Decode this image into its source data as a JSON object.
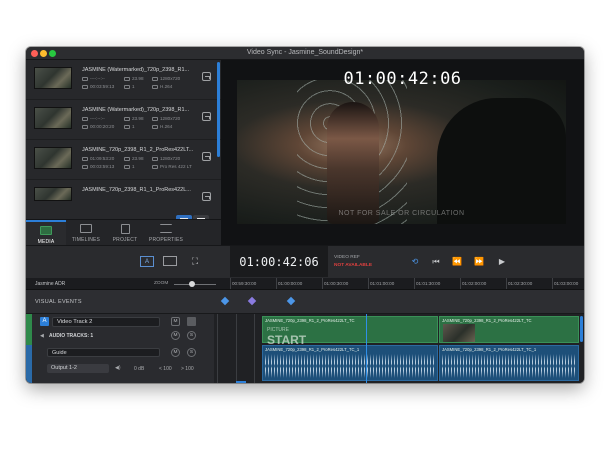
{
  "window": {
    "title": "Video Sync - Jasmine_SoundDesign*"
  },
  "media_items": [
    {
      "name": "JASMINE (Watermarked)_720p_2398_R1...",
      "row1a": "----:--:--",
      "row1b": "23.98",
      "row1c": "1280x720",
      "row2a": "00:03:59:13",
      "row2b": "1",
      "row2c": "H.264"
    },
    {
      "name": "JASMINE (Watermarked)_720p_2398_R1...",
      "row1a": "----:--:--",
      "row1b": "23.98",
      "row1c": "1280x720",
      "row2a": "00:00:20:20",
      "row2b": "1",
      "row2c": "H.264"
    },
    {
      "name": "JASMINE_720p_2398_R1_2_ProRes422LT...",
      "row1a": "01:09:53:20",
      "row1b": "23.98",
      "row1c": "1280x720",
      "row2a": "00:03:59:13",
      "row2b": "1",
      "row2c": "Pro Res 422 LT"
    },
    {
      "name": "JASMINE_720p_2398_R1_1_ProRes422L...",
      "row1a": "",
      "row1b": "",
      "row1c": "",
      "row2a": "",
      "row2b": "",
      "row2c": ""
    }
  ],
  "tabs": [
    {
      "label": "MEDIA",
      "icon": "film-icon"
    },
    {
      "label": "TIMELINES",
      "icon": "timeline-icon"
    },
    {
      "label": "PROJECT",
      "icon": "document-icon"
    },
    {
      "label": "PROPERTIES",
      "icon": "list-icon"
    }
  ],
  "viewer": {
    "timecode_overlay": "01:00:42:06",
    "watermark": "NOT FOR SALE OR CIRCULATION"
  },
  "transport": {
    "timecode": "01:00:42:06",
    "video_ref_label": "VIDEO REF",
    "video_ref_status": "NOT AVAILABLE",
    "a_button": "A"
  },
  "timeline_header": {
    "project": "Jasmine ADR",
    "zoom_label": "ZOOM",
    "ruler": [
      "00:59:30:00",
      "01:00:00:00",
      "01:00:30:00",
      "01:01:00:00",
      "01:01:30:00",
      "01:02:00:00",
      "01:02:30:00",
      "01:03:00:00"
    ]
  },
  "visual_events": {
    "label": "VISUAL EVENTS"
  },
  "video_track": {
    "letter": "A",
    "name": "Video Track 2",
    "mute": "M",
    "audio_tracks_label": "AUDIO TRACKS: 1",
    "clip1_label": "JASMINE_720p_2398_R1_2_ProRes422LT_TC",
    "clip2_label": "JASMINE_720p_2398_R1_2_ProRes422LT_TC",
    "start_top": "PICTURE",
    "start_main": "START"
  },
  "audio_track": {
    "name": "Guide",
    "mute": "M",
    "solo": "S",
    "output": "Output 1-2",
    "gain": "0 dB",
    "pan_left": "< 100",
    "pan_right": "> 100",
    "clip1_label": "JASMINE_720p_2398_R1_2_ProRes422LT_TC_1",
    "clip2_label": "JASMINE_720p_2398_R1_2_ProRes422LT_TC_1"
  },
  "colors": {
    "accent": "#2c7fd8",
    "video_clip": "#2c7144",
    "audio_clip": "#1d4f79",
    "alert": "#e0403f"
  }
}
